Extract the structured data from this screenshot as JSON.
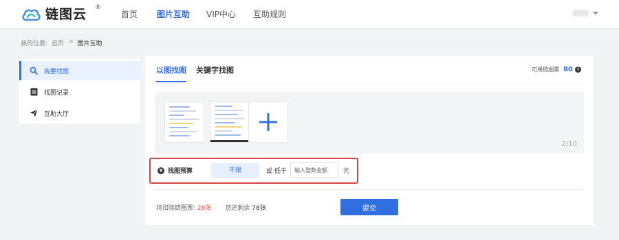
{
  "brand": {
    "name": "链图云",
    "reg": "®",
    "colors": {
      "blue": "#2f6fe0",
      "cloud_blue": "#4a90e2",
      "cloud_teal": "#2ec4b6"
    }
  },
  "nav": {
    "items": [
      {
        "label": "首页",
        "active": false
      },
      {
        "label": "图片互助",
        "active": true
      },
      {
        "label": "VIP中心",
        "active": false
      },
      {
        "label": "互助规则",
        "active": false
      }
    ]
  },
  "breadcrumb": {
    "prefix": "我的位置:",
    "home": "首页",
    "sep": ">",
    "current": "图片互助"
  },
  "sidebar": {
    "items": [
      {
        "label": "我要找图",
        "icon": "search-icon",
        "active": true
      },
      {
        "label": "找图记录",
        "icon": "list-icon",
        "active": false
      },
      {
        "label": "互助大厅",
        "icon": "paper-plane-icon",
        "active": false
      }
    ]
  },
  "main": {
    "tabs": [
      {
        "label": "以图找图",
        "active": true
      },
      {
        "label": "关键字找图",
        "active": false
      }
    ],
    "available": {
      "label": "可用链图票",
      "value": "80"
    },
    "upload": {
      "counter": "2/10"
    },
    "budget": {
      "label": "找图预算",
      "unlimited_label": "不限",
      "or_text": "或 低于",
      "amount_placeholder": "输入整数金额",
      "unit": "元"
    },
    "summary": {
      "deduct_label": "将扣除链图票:",
      "deduct_value": "28张",
      "remain_label": "您还剩余",
      "remain_value": "78张"
    },
    "submit_label": "提交"
  }
}
